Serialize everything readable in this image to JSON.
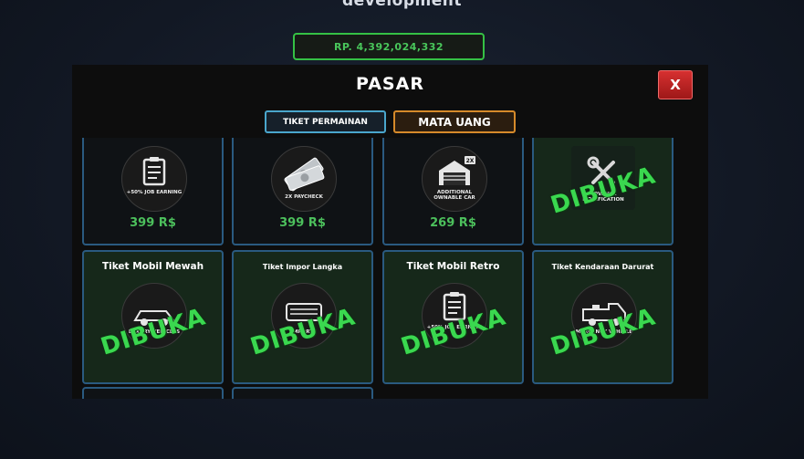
{
  "background_title": "development",
  "balance": "RP. 4,392,024,332",
  "modal": {
    "title": "PASAR",
    "close_label": "X",
    "tabs": [
      "TIKET PERMAINAN",
      "MATA UANG"
    ]
  },
  "stamp_text": "DIBUKA",
  "items_row1": [
    {
      "caption": "+50% JOB EARNING",
      "price": "399 R$",
      "icon": "clipboard-icon"
    },
    {
      "caption": "2X PAYCHECK",
      "price": "399 R$",
      "icon": "cash-icon"
    },
    {
      "caption": "ADDITIONAL OWNABLE CAR",
      "price": "269 R$",
      "icon": "garage-icon"
    },
    {
      "caption": "ADVANCE MODIFICATION",
      "icon": "wrench-icon"
    }
  ],
  "items_row2": [
    {
      "title": "Tiket Mobil Mewah",
      "caption": "LUXURY VEHICLES",
      "icon": "luxury-car-icon"
    },
    {
      "title": "Tiket Impor Langka",
      "caption": "IMPORTS",
      "icon": "import-car-icon"
    },
    {
      "title": "Tiket Mobil Retro",
      "caption": "+50% JOB EARNING",
      "icon": "clipboard-icon"
    },
    {
      "title": "Tiket Kendaraan Darurat",
      "caption": "EMERGENCY VEHICLES",
      "icon": "emergency-vehicle-icon"
    }
  ],
  "colors": {
    "accent_green": "#3ad84f",
    "price_green": "#4cc05c",
    "tab_blue": "#4aa6cc",
    "tab_orange": "#d68a2a",
    "close_red": "#c42424"
  }
}
